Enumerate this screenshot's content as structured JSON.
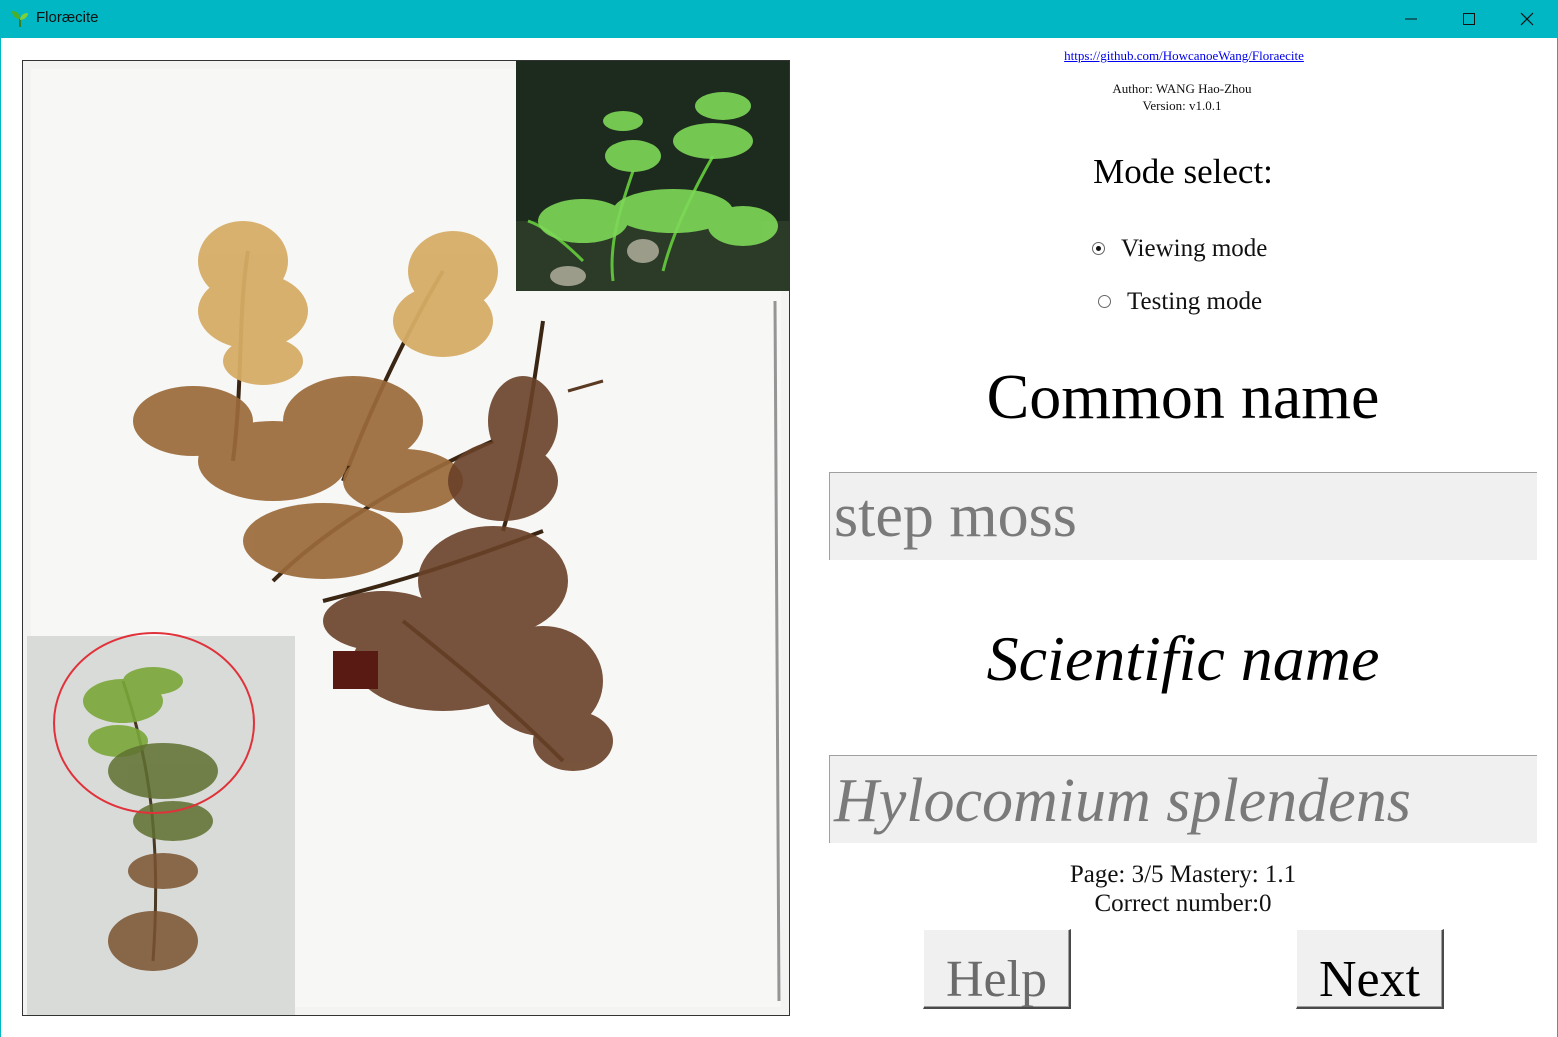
{
  "window": {
    "title": "Floræcite",
    "controls": [
      "minimize-icon",
      "maximize-icon",
      "close-icon"
    ]
  },
  "colors": {
    "titlebar": "#00b7c3",
    "field_background": "#f0f0f0",
    "field_text": "#7a7a7a",
    "link": "#0000ee",
    "highlight_circle": "#e0323a"
  },
  "header": {
    "repo_link": "https://github.com/HowcanoeWang/Floraecite",
    "author": "Author: WANG Hao-Zhou",
    "version": "Version: v1.0.1"
  },
  "mode": {
    "title": "Mode select:",
    "options": [
      {
        "label": "Viewing mode",
        "selected": true
      },
      {
        "label": "Testing mode",
        "selected": false
      }
    ]
  },
  "common": {
    "heading": "Common name",
    "value": "step moss"
  },
  "scientific": {
    "heading": "Scientific name",
    "value": "Hylocomium splendens"
  },
  "status": {
    "page_mastery": "Page: 3/5  Mastery: 1.1",
    "correct": "Correct number:0"
  },
  "buttons": {
    "help": "Help",
    "next": "Next"
  }
}
